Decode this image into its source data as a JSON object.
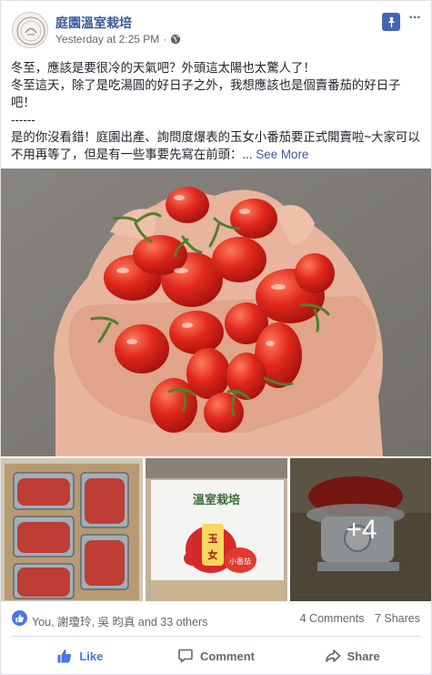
{
  "post": {
    "page_name": "庭園溫室栽培",
    "timestamp": "Yesterday at 2:25 PM",
    "separator": "·",
    "text_lines": [
      "冬至，應該是要很冷的天氣吧？外頭這太陽也太驚人了！",
      "冬至這天，除了是吃湯圓的好日子之外，我想應該也是個賣番茄的好日子吧！",
      "------",
      "是的你沒看錯！庭園出產、詢問度爆表的玉女小番茄要正式開賣啦~大家可以不用再等了，但是有一些事要先寫在前頭：..."
    ],
    "see_more": "See More",
    "extra_photo_count": "+4"
  },
  "reactions": {
    "names": "You, 謝瓊玲, 吳 昀真 and 33 others",
    "comments": "4 Comments",
    "shares": "7 Shares"
  },
  "actions": {
    "like": "Like",
    "comment": "Comment",
    "share": "Share"
  },
  "colors": {
    "link": "#385898",
    "brand": "#4267b2",
    "like_blue": "#4a76e8",
    "muted": "#606770"
  },
  "icons": {
    "pin": "pin-icon",
    "more": "more-options-icon",
    "globe": "globe-icon",
    "like_reaction": "thumbs-up-icon",
    "like_action": "thumbs-up-icon",
    "comment_action": "speech-bubble-icon",
    "share_action": "share-arrow-icon"
  }
}
